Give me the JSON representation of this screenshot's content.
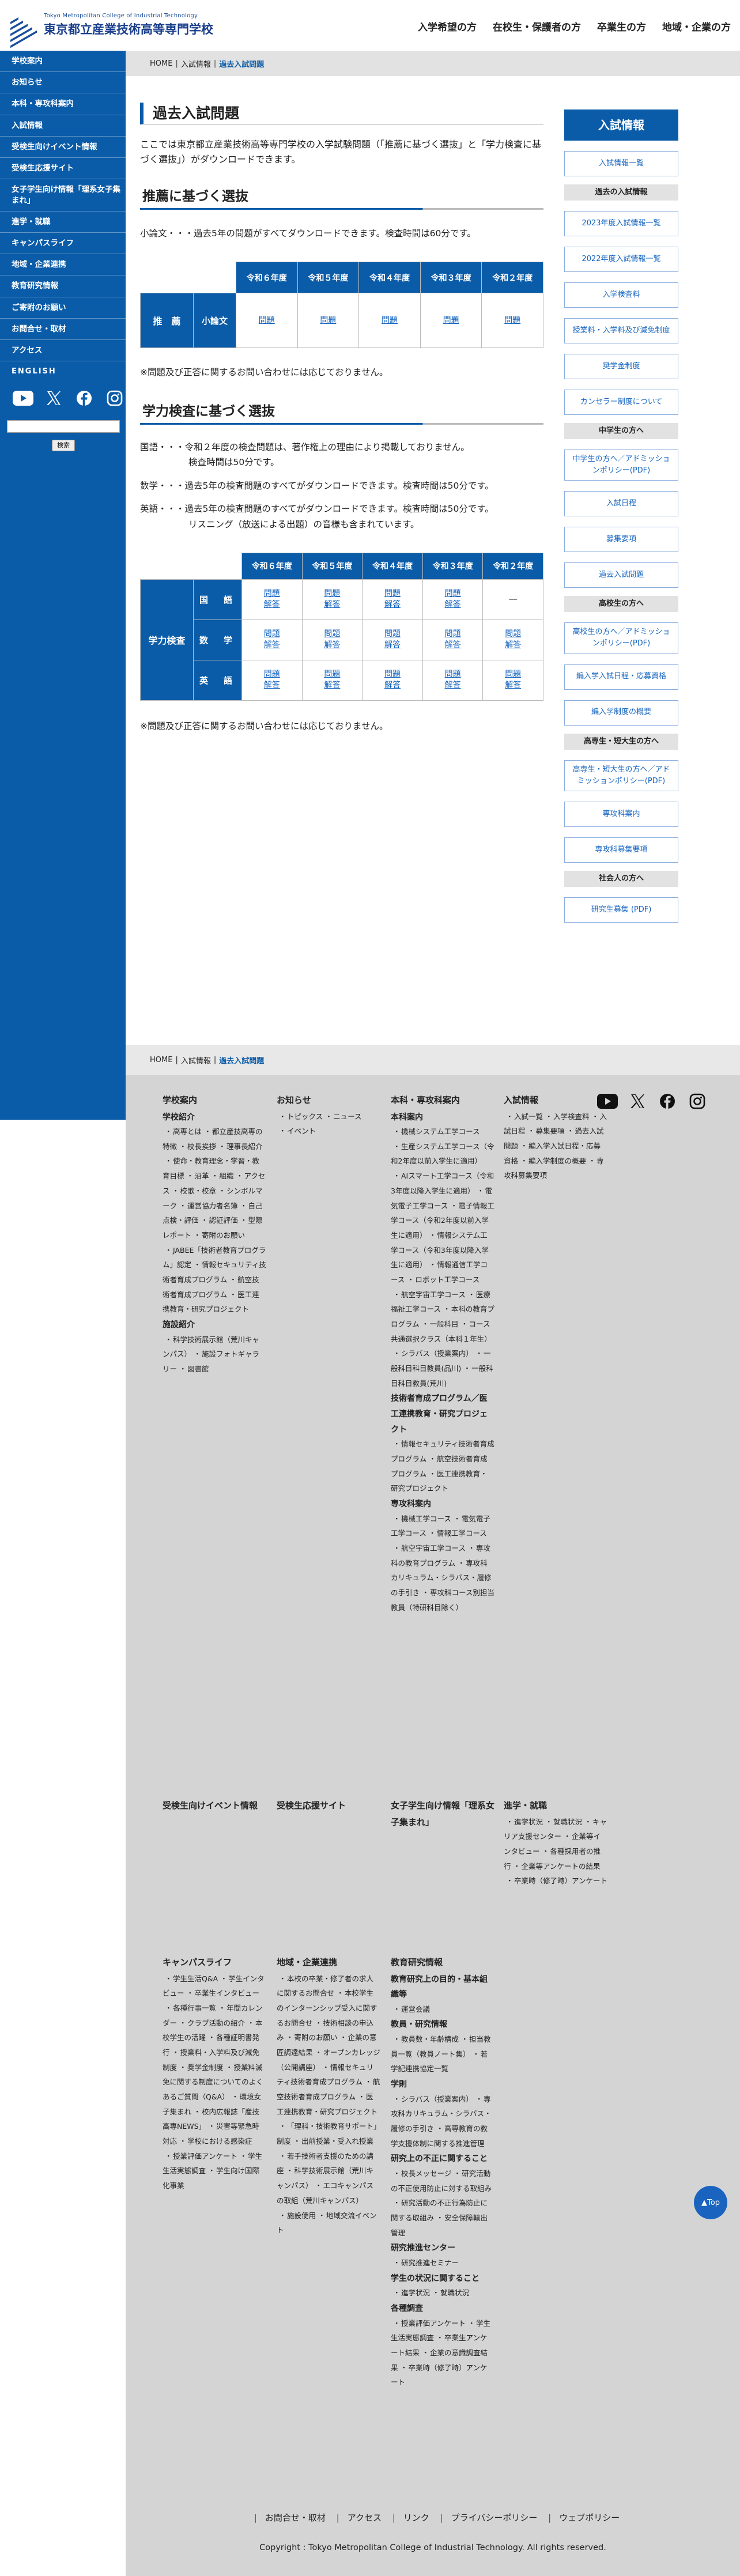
{
  "header": {
    "logo_en": "Tokyo Metropolitan College of Industrial Technology",
    "logo_ja": "東京都立産業技術高等専門学校",
    "nav": [
      "入学希望の方",
      "在校生・保護者の方",
      "卒業生の方",
      "地域・企業の方"
    ]
  },
  "sidebar": {
    "items": [
      "学校案内",
      "お知らせ",
      "本科・専攻科案内",
      "入試情報",
      "受検生向けイベント情報",
      "受検生応援サイト",
      "女子学生向け情報「理系女子集まれ」",
      "進学・就職",
      "キャンパスライフ",
      "地域・企業連携",
      "教育研究情報",
      "ご寄附のお願い",
      "お問合せ・取材",
      "アクセス",
      "ENGLISH"
    ],
    "search_button": "検索"
  },
  "breadcrumb": [
    "HOME",
    "入試情報",
    "過去入試問題"
  ],
  "main": {
    "title": "過去入試問題",
    "lead": "ここでは東京都立産業技術高等専門学校の入学試験問題（「推薦に基づく選抜」と「学力検査に基づく選抜」）がダウンロードできます。",
    "sec1": {
      "heading": "推薦に基づく選抜",
      "text": "小論文・・・過去5年の問題がすべてダウンロードできます。検査時間は60分です。",
      "years": [
        "令和６年度",
        "令和５年度",
        "令和４年度",
        "令和３年度",
        "令和２年度"
      ],
      "row_label1": "推　薦",
      "row_label2": "小論文",
      "cells": [
        "問題",
        "問題",
        "問題",
        "問題",
        "問題"
      ],
      "note": "※問題及び正答に関するお問い合わせには応じておりません。"
    },
    "sec2": {
      "heading": "学力検査に基づく選抜",
      "texts": [
        "国語・・・令和２年度の検査問題は、著作権上の理由により掲載しておりません。",
        "検査時間は50分です。",
        "数学・・・過去5年の検査問題のすべてがダウンロードできます。検査時間は50分です。",
        "英語・・・過去5年の検査問題のすべてがダウンロードできます。検査時間は50分です。",
        "リスニング（放送による出題）の音様も含まれています。"
      ],
      "years": [
        "令和６年度",
        "令和５年度",
        "令和４年度",
        "令和３年度",
        "令和２年度"
      ],
      "group_label": "学力検査",
      "rows": [
        {
          "label": "国　語",
          "cells": [
            [
              "問題",
              "解答"
            ],
            [
              "問題",
              "解答"
            ],
            [
              "問題",
              "解答"
            ],
            [
              "問題",
              "解答"
            ],
            [
              "―"
            ]
          ]
        },
        {
          "label": "数　学",
          "cells": [
            [
              "問題",
              "解答"
            ],
            [
              "問題",
              "解答"
            ],
            [
              "問題",
              "解答"
            ],
            [
              "問題",
              "解答"
            ],
            [
              "問題",
              "解答"
            ]
          ]
        },
        {
          "label": "英　語",
          "cells": [
            [
              "問題",
              "解答"
            ],
            [
              "問題",
              "解答"
            ],
            [
              "問題",
              "解答"
            ],
            [
              "問題",
              "解答"
            ],
            [
              "問題",
              "解答"
            ]
          ]
        }
      ],
      "note": "※問題及び正答に関するお問い合わせには応じておりません。"
    }
  },
  "right": {
    "head": "入試情報",
    "blocks": [
      {
        "type": "btn",
        "text": "入試情報一覧"
      },
      {
        "type": "cat",
        "text": "過去の入試情報"
      },
      {
        "type": "btn",
        "text": "2023年度入試情報一覧"
      },
      {
        "type": "btn",
        "text": "2022年度入試情報一覧"
      },
      {
        "type": "btn",
        "text": "入学検査料"
      },
      {
        "type": "btn",
        "text": "授業料・入学料及び減免制度"
      },
      {
        "type": "btn",
        "text": "奨学金制度"
      },
      {
        "type": "btn",
        "text": "カンセラー制度について"
      },
      {
        "type": "cat",
        "text": "中学生の方へ"
      },
      {
        "type": "btn",
        "text": "中学生の方へ／アドミッションポリシー(PDF)"
      },
      {
        "type": "btn",
        "text": "入試日程"
      },
      {
        "type": "btn",
        "text": "募集要項"
      },
      {
        "type": "btn",
        "text": "過去入試問題"
      },
      {
        "type": "cat",
        "text": "高校生の方へ"
      },
      {
        "type": "btn",
        "text": "高校生の方へ／アドミッションポリシー(PDF)"
      },
      {
        "type": "btn",
        "text": "編入学入試日程・応募資格"
      },
      {
        "type": "btn",
        "text": "編入学制度の概要"
      },
      {
        "type": "cat",
        "text": "高専生・短大生の方へ"
      },
      {
        "type": "btn",
        "text": "高専生・短大生の方へ／アドミッションポリシー(PDF)"
      },
      {
        "type": "btn",
        "text": "専攻科案内"
      },
      {
        "type": "btn",
        "text": "専攻科募集要項"
      },
      {
        "type": "cat",
        "text": "社会人の方へ"
      },
      {
        "type": "btn",
        "text": "研究生募集 (PDF)"
      }
    ]
  },
  "footer": {
    "breadcrumb": [
      "HOME",
      "入試情報",
      "過去入試問題"
    ],
    "col1": {
      "title": "学校案内",
      "groups": [
        {
          "sub": "学校紹介",
          "items": [
            "高専とは",
            "都立産技高専の特徴",
            "校長挨拶",
            "理事長紹介",
            "使命・教育理念・学習・教育目標",
            "沿革",
            "組織",
            "アクセス",
            "校歌・校章",
            "シンボルマーク",
            "運営協力者名簿",
            "自己点検・評価",
            "認証評価",
            "型際レポート",
            "寄附のお願い",
            "JABEE「技術者教育プログラム」認定",
            "情報セキュリティ技術者育成プログラム",
            "航空技術者育成プログラム",
            "医工連携教育・研究プロジェクト"
          ]
        },
        {
          "sub": "施設紹介",
          "items": [
            "科学技術展示館（荒川キャンパス）",
            "施設フォトギャラリー",
            "図書館"
          ]
        }
      ]
    },
    "col2": {
      "title": "お知らせ",
      "items": [
        "トピックス",
        "ニュース",
        "イベント"
      ]
    },
    "col3": {
      "title": "本科・専攻科案内",
      "groups": [
        {
          "sub": "本科案内",
          "items": [
            "機械システム工学コース",
            "生産システム工学コース（令和2年度以前入学生に適用）",
            "AIスマート工学コース（令和3年度以降入学生に適用）",
            "電気電子工学コース",
            "電子情報工学コース（令和2年度以前入学生に適用）",
            "情報システム工学コース（令和3年度以降入学生に適用）",
            "情報通信工学コース",
            "ロボット工学コース",
            "航空宇宙工学コース",
            "医療福祉工学コース",
            "本科の教育プログラム",
            "一般科目",
            "コース共通選択クラス（本科１年生）",
            "シラバス（授業案内）",
            "一般科目科目教員(品川)",
            "一般科目科目教員(荒川)"
          ]
        },
        {
          "sub": "技術者育成プログラム／医工連携教育・研究プロジェクト",
          "items": [
            "情報セキュリティ技術者育成プログラム",
            "航空技術者育成プログラム",
            "医工連携教育・研究プロジェクト"
          ]
        },
        {
          "sub": "専攻科案内",
          "items": [
            "機械工学コース",
            "電気電子工学コース",
            "情報工学コース",
            "航空宇宙工学コース",
            "専攻科の教育プログラム",
            "専攻科カリキュラム・シラバス・履修の手引き",
            "専攻科コース別担当教員（特研科目除く）"
          ]
        }
      ]
    },
    "col4": {
      "title": "入試情報",
      "items": [
        "入試一覧",
        "入学検査料",
        "入試日程",
        "募集要項",
        "過去入試問題",
        "編入学入試日程・応募資格",
        "編入学制度の概要",
        "専攻科募集要項"
      ]
    },
    "row2": [
      {
        "title": "受検生向けイベント情報",
        "items": []
      },
      {
        "title": "受検生応援サイト",
        "items": []
      },
      {
        "title": "女子学生向け情報「理系女子集まれ」",
        "items": []
      },
      {
        "title": "進学・就職",
        "items": [
          "進学状況",
          "就職状況",
          "キャリア支援センター",
          "企業等インタビュー",
          "各種採用者の推行",
          "企業等アンケートの結果",
          "卒業時（修了時）アンケート"
        ]
      }
    ],
    "col_campus": {
      "title": "キャンパスライフ",
      "items": [
        "学生生活Q&A",
        "学生インタビュー",
        "卒業生インタビュー",
        "各種行事一覧",
        "年間カレンダー",
        "クラブ活動の紹介",
        "本校学生の活躍",
        "各種証明書発行",
        "授業料・入学料及び減免制度",
        "奨学金制度",
        "授業料減免に関する制度についてのよくあるご質問（Q&A）",
        "環境女子集まれ",
        "校内広報誌「産技高専NEWS」",
        "災害等緊急時対応",
        "学校における感染症",
        "授業評価アンケート",
        "学生生活実態調査",
        "学生向け国際化事業"
      ]
    },
    "col_region": {
      "title": "地域・企業連携",
      "items": [
        "本校の卒業・修了者の求人に関するお問合せ",
        "本校学生のインターンシップ受入に関するお問合せ",
        "技術相談の申込み",
        "寄附のお願い",
        "企業の意匠調達結果",
        "オープンカレッジ（公開講座）",
        "情報セキュリティ技術者育成プログラム",
        "航空技術者育成プログラム",
        "医工連携教育・研究プロジェクト",
        "「理科・技術教育サポート」制度",
        "出前授業・受入れ授業",
        "若手技術者支援のための講座",
        "科学技術展示館（荒川キャンパス）",
        "エコキャンパスの取組（荒川キャンパス）",
        "施設使用",
        "地域交流イベント"
      ]
    },
    "col_edu": {
      "title": "教育研究情報",
      "groups": [
        {
          "sub": "教育研究上の目的・基本組織等",
          "items": [
            "運営会議"
          ]
        },
        {
          "sub": "教員・研究情報",
          "items": [
            "教員数・年齢構成",
            "担当教員一覧（教員ノート集）",
            "若学記連携協定一覧"
          ]
        },
        {
          "sub": "学則",
          "items": [
            "シラバス（授業案内）",
            "専攻科カリキュラム・シラバス・履修の手引き",
            "高専教育の教学支援体制に関する推進管理"
          ]
        },
        {
          "sub": "研究上の不正に関すること",
          "items": [
            "校長メッセージ",
            "研究活動の不正使用防止に対する取組み",
            "研究活動の不正行為防止に関する取組み",
            "安全保障輸出管理"
          ]
        },
        {
          "sub": "研究推進センター",
          "items": [
            "研究推進セミナー"
          ]
        },
        {
          "sub": "学生の状況に関すること",
          "items": [
            "進学状況",
            "就職状況"
          ]
        },
        {
          "sub": "各種調査",
          "items": [
            "授業評価アンケート",
            "学生生活実態調査",
            "卒業生アンケート結果",
            "企業の意識調査結果",
            "卒業時（修了時）アンケート"
          ]
        }
      ]
    },
    "links": [
      "お問合せ・取材",
      "アクセス",
      "リンク",
      "プライバシーポリシー",
      "ウェブポリシー"
    ],
    "copyright": "Copyright : Tokyo Metropolitan College of Industrial Technology. All rights reserved.",
    "totop": "▲Top"
  },
  "icons": [
    "youtube-icon",
    "x-icon",
    "facebook-icon",
    "instagram-icon"
  ],
  "colors": {
    "primary": "#0b5ca8",
    "link": "#1565c0",
    "footer_bg": "#d4d4d4"
  }
}
